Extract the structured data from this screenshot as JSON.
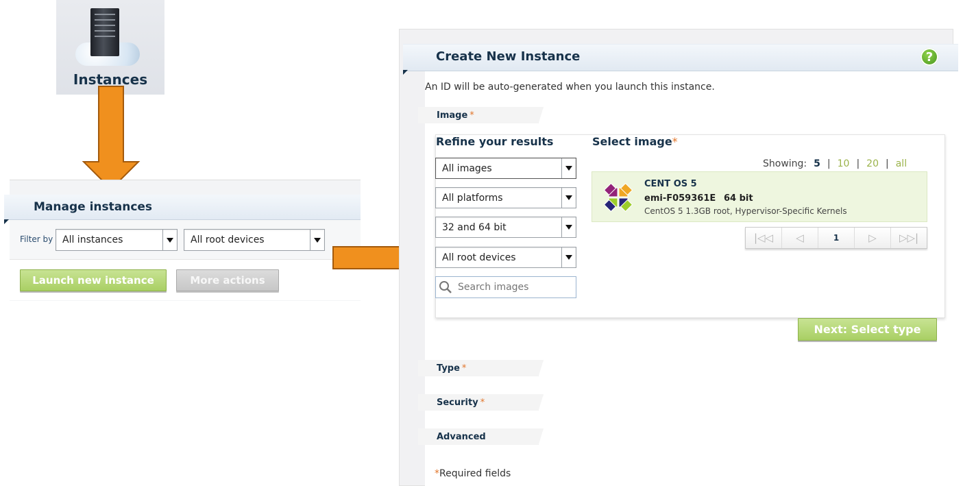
{
  "instances_tile": {
    "label": "Instances"
  },
  "manage": {
    "title": "Manage instances",
    "filter_label": "Filter by",
    "filter_instances": "All instances",
    "filter_root_devices": "All root devices",
    "launch_label": "Launch new instance",
    "more_actions_label": "More actions"
  },
  "create": {
    "title": "Create New Instance",
    "help_glyph": "?",
    "id_note": "An ID will be auto-generated when you launch this instance.",
    "required_mark": "*",
    "steps": {
      "image": "Image",
      "type": "Type",
      "security": "Security",
      "advanced": "Advanced"
    },
    "refine_title": "Refine your results",
    "select_image_title": "Select image",
    "filters": {
      "images": "All images",
      "platforms": "All platforms",
      "arch": "32 and 64 bit",
      "root_devices": "All root devices"
    },
    "search_placeholder": "Search images",
    "showing": {
      "label": "Showing:",
      "options": [
        "5",
        "10",
        "20",
        "all"
      ],
      "separator": "|"
    },
    "image_result": {
      "name": "CENT OS 5",
      "id": "emi-F059361E",
      "arch": "64 bit",
      "description": "CentOS 5 1.3GB root, Hypervisor-Specific Kernels"
    },
    "pager": {
      "first": "|◁◁",
      "prev": "◁",
      "current": "1",
      "next": "▷",
      "last": "▷▷|"
    },
    "next_label": "Next: Select type",
    "required_note": "Required fields"
  },
  "colors": {
    "accent_orange": "#f0901e",
    "title_navy": "#17324a",
    "button_green": "#a9cf64",
    "required_orange": "#e2762b"
  }
}
